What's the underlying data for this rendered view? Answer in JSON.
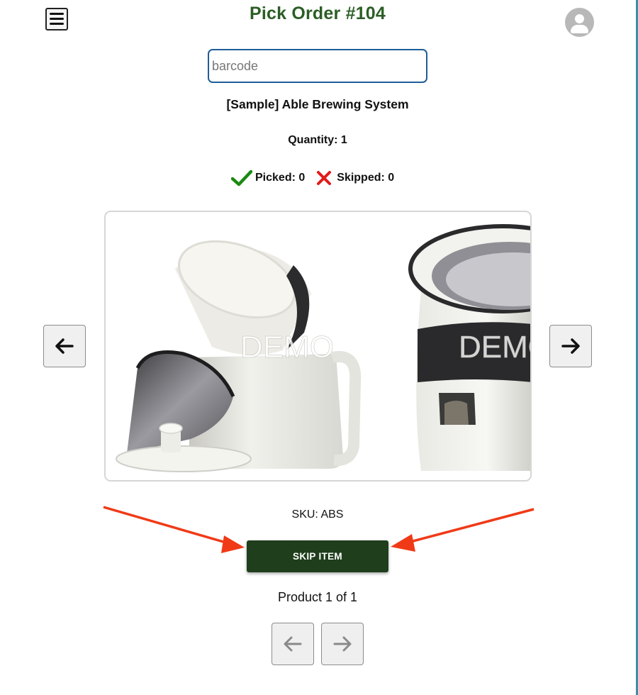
{
  "header": {
    "title": "Pick Order #104",
    "menu_icon": "menu-icon",
    "avatar_icon": "account-circle-icon",
    "title_color": "#2b5e25"
  },
  "scanner": {
    "placeholder": "barcode",
    "value": ""
  },
  "product": {
    "name": "[Sample] Able Brewing System",
    "quantity_text": "Quantity: 1",
    "picked_text": "Picked: 0",
    "skipped_text": "Skipped: 0",
    "sku_text": "SKU: ABS",
    "image_watermark": "DEMO"
  },
  "carousel": {
    "prev_icon": "arrow-left-icon",
    "next_icon": "arrow-right-icon"
  },
  "actions": {
    "skip_label": "SKIP ITEM",
    "skip_color": "#1f3e1c"
  },
  "pagination": {
    "count_text": "Product 1 of 1",
    "prev_icon": "arrow-left-icon",
    "next_icon": "arrow-right-icon"
  },
  "colors": {
    "picked": "#1a8a12",
    "skipped": "#e31b1b",
    "annotation_arrow": "#f03a17",
    "input_border": "#1f5d99"
  }
}
